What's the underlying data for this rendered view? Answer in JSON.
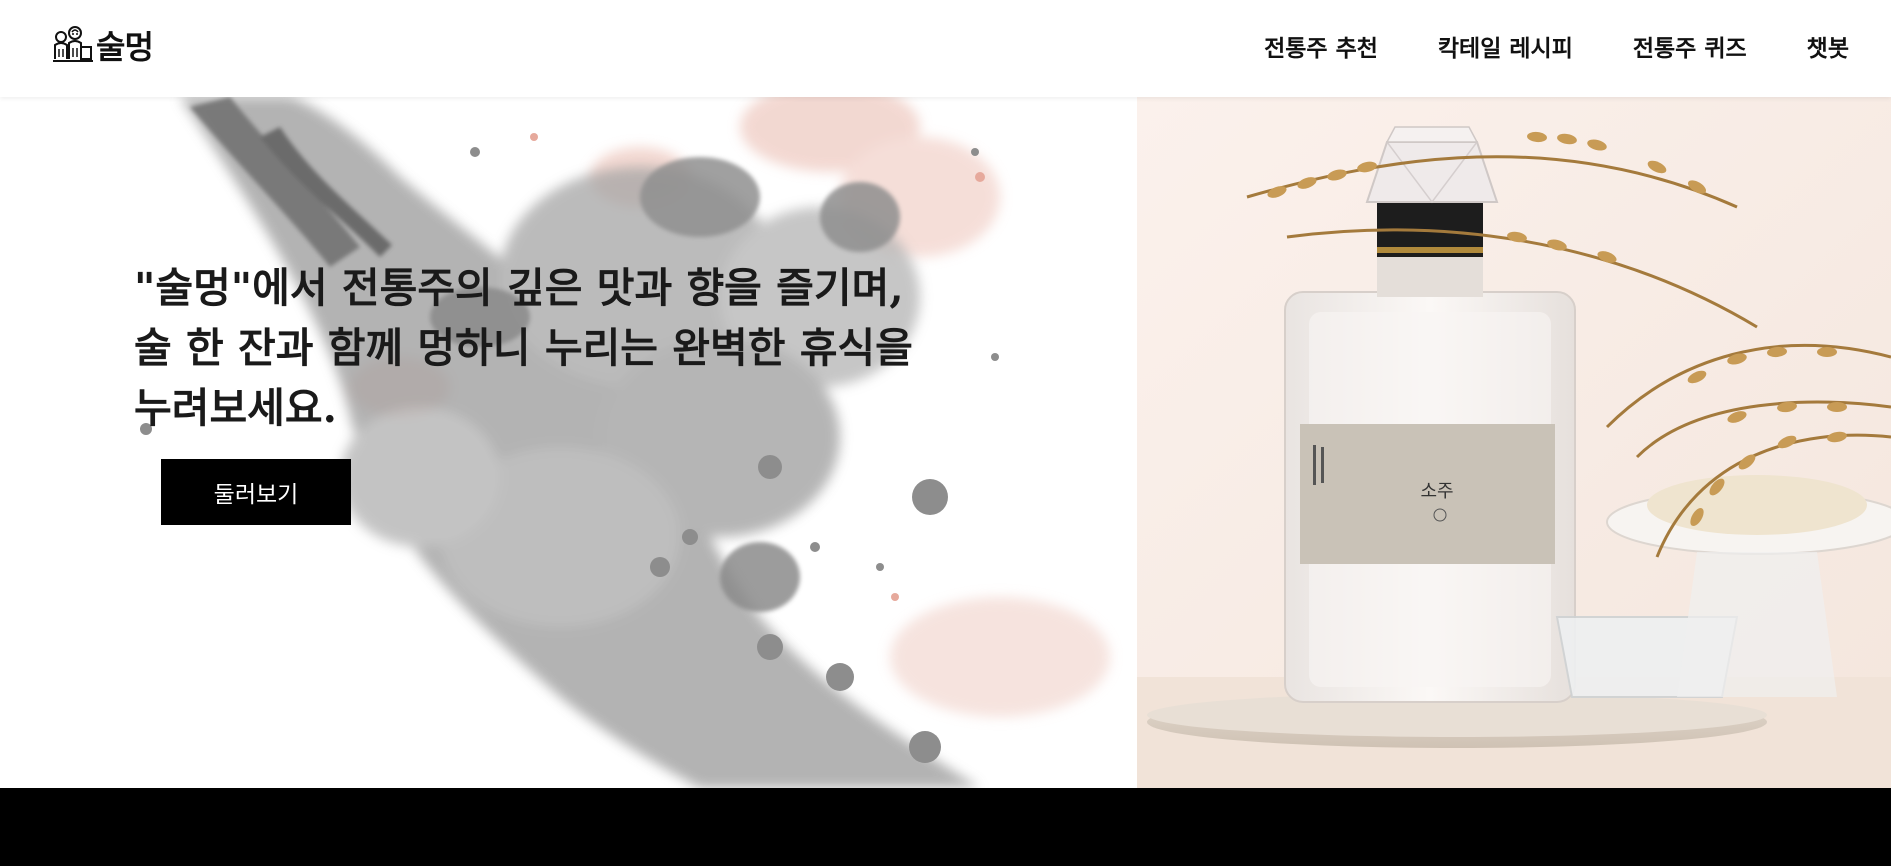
{
  "brand": {
    "name": "술멍",
    "logo_icon": "drinking-people-icon"
  },
  "nav": {
    "items": [
      {
        "label": "전통주 추천"
      },
      {
        "label": "칵테일 레시피"
      },
      {
        "label": "전통주 퀴즈"
      },
      {
        "label": "챗봇"
      }
    ]
  },
  "hero": {
    "headline_lines": [
      "\"술멍\"에서 전통주의 깊은 맛과 향을 즐기며,",
      "술 한 잔과 함께 멍하니 누리는 완벽한 휴식을",
      "누려보세요."
    ],
    "cta_label": "둘러보기",
    "background": "ink-splash",
    "product_image": "soju-bottle-with-rice-stalks"
  },
  "colors": {
    "header_bg": "#ffffff",
    "text": "#111111",
    "cta_bg": "#000000",
    "cta_text": "#ffffff",
    "footer_bg": "#000000",
    "ink_gray": "#8a8a8a",
    "ink_pink": "#e8b8ad"
  }
}
